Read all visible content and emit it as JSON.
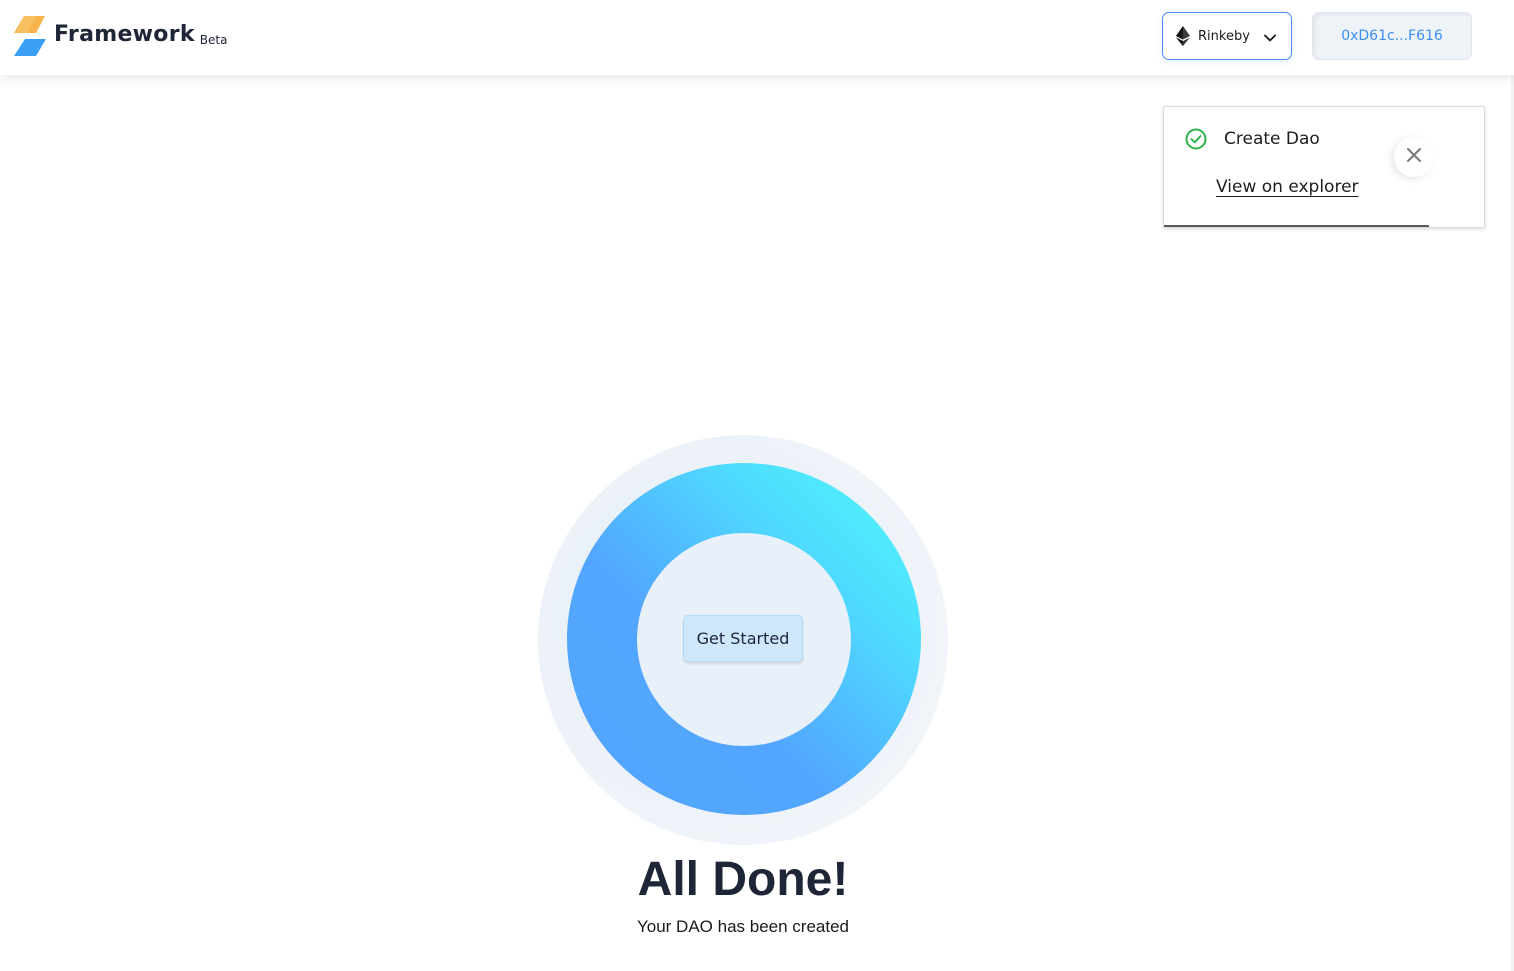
{
  "header": {
    "app_name": "Framework",
    "tag": "Beta",
    "network": {
      "label": "Rinkeby",
      "icon": "ethereum-icon"
    },
    "account": {
      "address": "0xD61c...F616"
    }
  },
  "toast": {
    "title": "Create Dao",
    "link_label": "View on explorer",
    "status_icon": "check-circle-icon",
    "status_color": "#2db34a"
  },
  "main": {
    "button_label": "Get Started",
    "title": "All Done!",
    "subtitle": "Your DAO has been created"
  },
  "colors": {
    "accent": "#3b8ff0",
    "gradient_start": "#52a5fd",
    "gradient_end": "#4ffdfb",
    "text_dark": "#1e2537"
  }
}
